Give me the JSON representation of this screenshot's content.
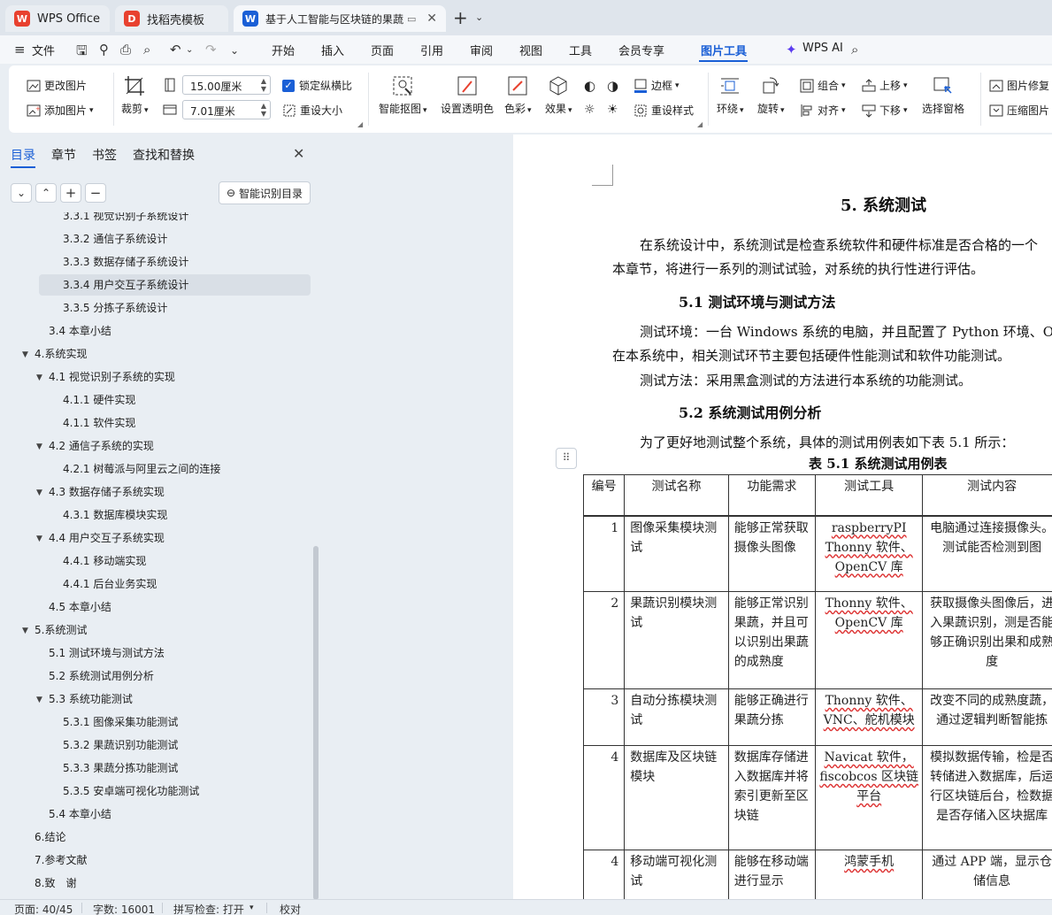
{
  "tabs": [
    {
      "label": "WPS Office",
      "icon": "wps-logo-icon",
      "color": "#e8412f"
    },
    {
      "label": "找稻壳模板",
      "icon": "docer-logo-icon",
      "color": "#e8412f"
    },
    {
      "label": "基于人工智能与区块链的果蔬",
      "icon": "wps-writer-icon",
      "color": "#1a5fd6"
    }
  ],
  "menubar": {
    "file": "文件",
    "items": [
      "开始",
      "插入",
      "页面",
      "引用",
      "审阅",
      "视图",
      "工具",
      "会员专享",
      "图片工具"
    ],
    "active": "图片工具",
    "ai": "WPS AI"
  },
  "ribbon": {
    "change_image": "更改图片",
    "add_image": "添加图片",
    "crop": "裁剪",
    "width": "15.00厘米",
    "height": "7.01厘米",
    "lock_ratio": "锁定纵横比",
    "reset_size": "重设大小",
    "smart_cutout": "智能抠图",
    "set_transparent": "设置透明色",
    "color": "色彩",
    "effect": "效果",
    "border": "边框",
    "reset_style": "重设样式",
    "wrap": "环绕",
    "rotate": "旋转",
    "group": "组合",
    "align": "对齐",
    "move_up": "上移",
    "move_down": "下移",
    "selection_pane": "选择窗格",
    "image_repair": "图片修复",
    "compress_image": "压缩图片"
  },
  "nav": {
    "tabs": [
      "目录",
      "章节",
      "书签",
      "查找和替换"
    ],
    "active_tab": "目录",
    "smart_toc": "智能识别目录",
    "toc": [
      {
        "label": "3.3.1 视觉识别子系统设计",
        "level": 3,
        "tri": ""
      },
      {
        "label": "3.3.2 通信子系统设计",
        "level": 3,
        "tri": ""
      },
      {
        "label": "3.3.3 数据存储子系统设计",
        "level": 3,
        "tri": ""
      },
      {
        "label": "3.3.4 用户交互子系统设计",
        "level": 3,
        "tri": "",
        "selected": true
      },
      {
        "label": "3.3.5 分拣子系统设计",
        "level": 3,
        "tri": ""
      },
      {
        "label": "3.4 本章小结",
        "level": 2,
        "tri": ""
      },
      {
        "label": "4.系统实现",
        "level": 1,
        "tri": "▼"
      },
      {
        "label": "4.1 视觉识别子系统的实现",
        "level": 2,
        "tri": "▼"
      },
      {
        "label": "4.1.1 硬件实现",
        "level": 3,
        "tri": ""
      },
      {
        "label": "4.1.1 软件实现",
        "level": 3,
        "tri": ""
      },
      {
        "label": "4.2 通信子系统的实现",
        "level": 2,
        "tri": "▼"
      },
      {
        "label": "4.2.1 树莓派与阿里云之间的连接",
        "level": 3,
        "tri": ""
      },
      {
        "label": "4.3 数据存储子系统实现",
        "level": 2,
        "tri": "▼"
      },
      {
        "label": "4.3.1 数据库模块实现",
        "level": 3,
        "tri": ""
      },
      {
        "label": "4.4 用户交互子系统实现",
        "level": 2,
        "tri": "▼"
      },
      {
        "label": "4.4.1 移动端实现",
        "level": 3,
        "tri": ""
      },
      {
        "label": "4.4.1 后台业务实现",
        "level": 3,
        "tri": ""
      },
      {
        "label": "4.5 本章小结",
        "level": 2,
        "tri": ""
      },
      {
        "label": "5.系统测试",
        "level": 1,
        "tri": "▼"
      },
      {
        "label": "5.1 测试环境与测试方法",
        "level": 2,
        "tri": ""
      },
      {
        "label": "5.2 系统测试用例分析",
        "level": 2,
        "tri": ""
      },
      {
        "label": "5.3 系统功能测试",
        "level": 2,
        "tri": "▼"
      },
      {
        "label": "5.3.1 图像采集功能测试",
        "level": 3,
        "tri": ""
      },
      {
        "label": "5.3.2 果蔬识别功能测试",
        "level": 3,
        "tri": ""
      },
      {
        "label": "5.3.3 果蔬分拣功能测试",
        "level": 3,
        "tri": ""
      },
      {
        "label": "5.3.5 安卓端可视化功能测试",
        "level": 3,
        "tri": ""
      },
      {
        "label": "5.4 本章小结",
        "level": 2,
        "tri": ""
      },
      {
        "label": "6.结论",
        "level": 1,
        "tri": ""
      },
      {
        "label": "7.参考文献",
        "level": 1,
        "tri": ""
      },
      {
        "label": "8.致　谢",
        "level": 1,
        "tri": ""
      }
    ]
  },
  "doc": {
    "h_chapter": "5. 系统测试",
    "p1a": "在系统设计中，系统测试是检查系统软件和硬件标准是否合格的一个",
    "p1b": "本章节，将进行一系列的测试试验，对系统的执行性进行评估。",
    "h_51": "5.1 测试环境与测试方法",
    "p2a": "测试环境：一台 Windows 系统的电脑，并且配置了 Python 环境、O",
    "p2b": "在本系统中，相关测试环节主要包括硬件性能测试和软件功能测试。",
    "p3": "测试方法：采用黑盒测试的方法进行本系统的功能测试。",
    "h_52": "5.2 系统测试用例分析",
    "p4": "为了更好地测试整个系统，具体的测试用例表如下表 5.1 所示：",
    "table_caption": "表 5.1  系统测试用例表",
    "table_header": [
      "编号",
      "测试名称",
      "功能需求",
      "测试工具",
      "测试内容"
    ],
    "table_rows": [
      {
        "no": "1",
        "name": "图像采集模块测试",
        "req": "能够正常获取摄像头图像",
        "tool": "raspberryPI Thonny 软件、OpenCV 库",
        "content": "电脑通过连接摄像头。测试能否检测到图"
      },
      {
        "no": "2",
        "name": "果蔬识别模块测试",
        "req": "能够正常识别果蔬，并且可以识别出果蔬的成熟度",
        "tool": "Thonny 软件、OpenCV 库",
        "content": "获取摄像头图像后，进入果蔬识别，测是否能够正确识别出果和成熟度"
      },
      {
        "no": "3",
        "name": "自动分拣模块测试",
        "req": "能够正确进行果蔬分拣",
        "tool": "Thonny 软件、VNC、舵机模块",
        "content": "改变不同的成熟度蔬，通过逻辑判断智能拣"
      },
      {
        "no": "4",
        "name": "数据库及区块链模块",
        "req": "数据库存储进入数据库并将索引更新至区块链",
        "tool": "Navicat 软件，fiscobcos 区块链平台",
        "content": "模拟数据传输，检是否转储进入数据库，后运行区块链后台，检数据是否存储入区块据库"
      },
      {
        "no": "4",
        "name": "移动端可视化测试",
        "req": "能够在移动端进行显示",
        "tool": "鸿蒙手机",
        "content": "通过 APP 端，显示仓储信息"
      }
    ]
  },
  "status": {
    "page": "页面: 40/45",
    "words": "字数: 16001",
    "spell": "拼写检查: 打开",
    "proof": "校对"
  }
}
